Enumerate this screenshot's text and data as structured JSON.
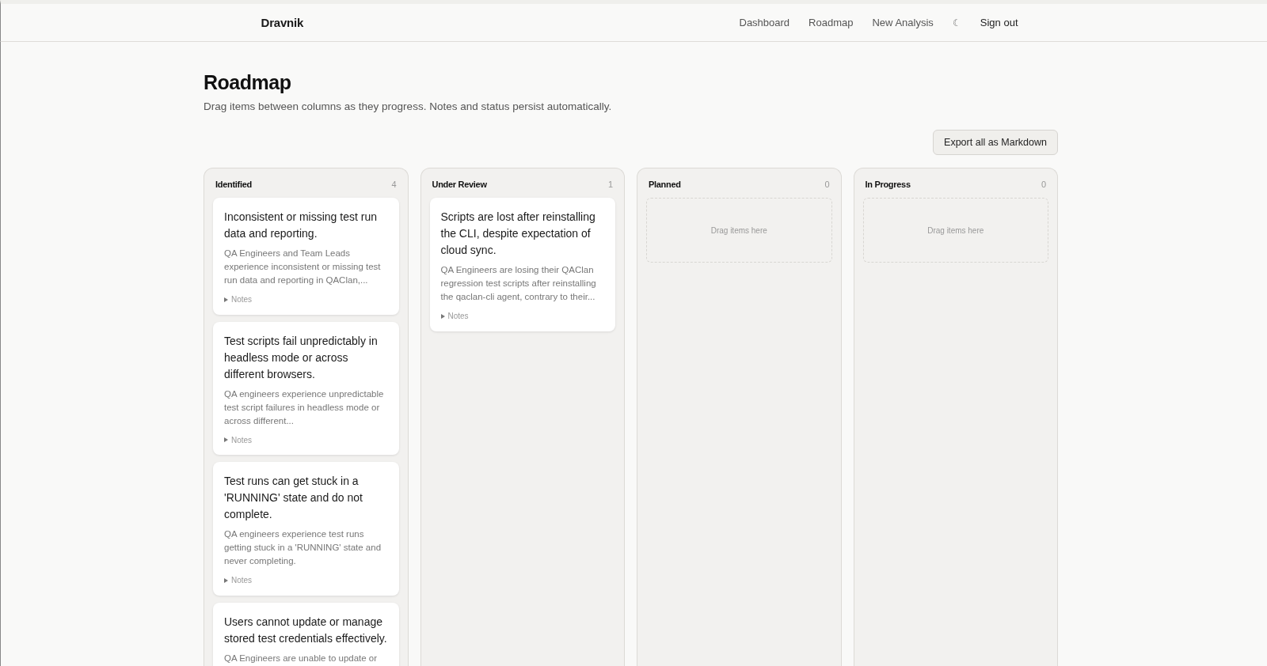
{
  "header": {
    "brand": "Dravnik",
    "nav": [
      {
        "label": "Dashboard",
        "kind": "link"
      },
      {
        "label": "Roadmap",
        "kind": "link"
      },
      {
        "label": "New Analysis",
        "kind": "link"
      },
      {
        "label": "☾",
        "kind": "toggle"
      },
      {
        "label": "Sign out",
        "kind": "button"
      }
    ]
  },
  "page": {
    "title": "Roadmap",
    "subtitle": "Drag items between columns as they progress. Notes and status persist automatically.",
    "export_button": "Export all as Markdown"
  },
  "columns": [
    {
      "title": "Identified",
      "count": "4",
      "cards": [
        {
          "title": "Inconsistent or missing test run data and reporting.",
          "description": "QA Engineers and Team Leads experience inconsistent or missing test run data and reporting in QAClan,...",
          "notes": "Notes"
        },
        {
          "title": "Test scripts fail unpredictably in headless mode or across different browsers.",
          "description": "QA engineers experience unpredictable test script failures in headless mode or across different...",
          "notes": "Notes"
        },
        {
          "title": "Test runs can get stuck in a 'RUNNING' state and do not complete.",
          "description": "QA engineers experience test runs getting stuck in a 'RUNNING' state and never completing.",
          "notes": "Notes"
        },
        {
          "title": "Users cannot update or manage stored test credentials effectively.",
          "description": "QA Engineers are unable to update or"
        }
      ]
    },
    {
      "title": "Under Review",
      "count": "1",
      "cards": [
        {
          "title": "Scripts are lost after reinstalling the CLI, despite expectation of cloud sync.",
          "description": "QA Engineers are losing their QAClan regression test scripts after reinstalling the qaclan-cli agent, contrary to their...",
          "notes": "Notes"
        }
      ]
    },
    {
      "title": "Planned",
      "count": "0",
      "empty_text": "Drag items here"
    },
    {
      "title": "In Progress",
      "count": "0",
      "empty_text": "Drag items here"
    }
  ]
}
